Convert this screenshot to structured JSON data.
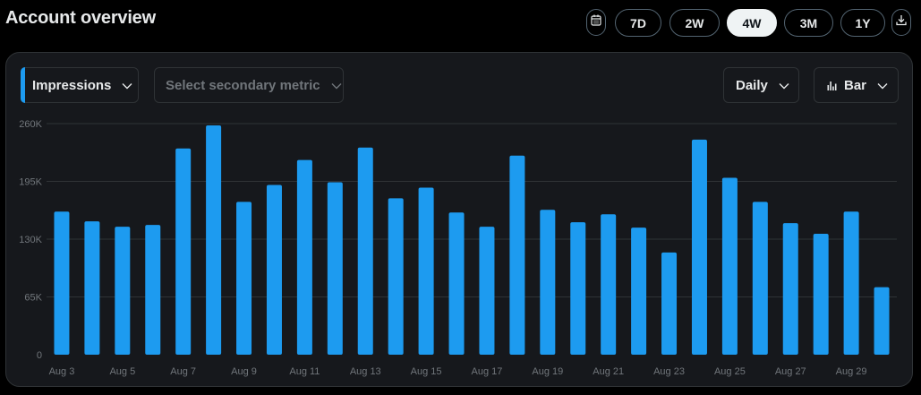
{
  "header": {
    "title": "Account overview"
  },
  "range": {
    "options": [
      "7D",
      "2W",
      "4W",
      "3M",
      "1Y"
    ],
    "selected": "4W",
    "calendar_icon": "calendar-icon",
    "download_icon": "download-icon"
  },
  "controls": {
    "primary_metric": "Impressions",
    "secondary_metric_placeholder": "Select secondary metric",
    "granularity": "Daily",
    "chart_type_label": "Bar",
    "chart_type_icon": "bar-chart-icon",
    "chevron_icon": "chevron-down-icon"
  },
  "colors": {
    "bar": "#1d9bf0",
    "grid": "#2f3336",
    "accent": "#1d9bf0"
  },
  "chart_data": {
    "type": "bar",
    "categories": [
      "Aug 3",
      "Aug 4",
      "Aug 5",
      "Aug 6",
      "Aug 7",
      "Aug 8",
      "Aug 9",
      "Aug 10",
      "Aug 11",
      "Aug 12",
      "Aug 13",
      "Aug 14",
      "Aug 15",
      "Aug 16",
      "Aug 17",
      "Aug 18",
      "Aug 19",
      "Aug 20",
      "Aug 21",
      "Aug 22",
      "Aug 23",
      "Aug 24",
      "Aug 25",
      "Aug 26",
      "Aug 27",
      "Aug 28",
      "Aug 29",
      "Aug 30"
    ],
    "tick_labels": [
      "Aug 3",
      "Aug 5",
      "Aug 7",
      "Aug 9",
      "Aug 11",
      "Aug 13",
      "Aug 15",
      "Aug 17",
      "Aug 19",
      "Aug 21",
      "Aug 23",
      "Aug 25",
      "Aug 27",
      "Aug 29"
    ],
    "values": [
      161000,
      150000,
      144000,
      146000,
      232000,
      258000,
      172000,
      191000,
      219000,
      194000,
      233000,
      176000,
      188000,
      160000,
      144000,
      224000,
      163000,
      149000,
      158000,
      143000,
      115000,
      242000,
      199000,
      172000,
      148000,
      136000,
      161000,
      76000
    ],
    "y_ticks": [
      "0",
      "65K",
      "130K",
      "195K",
      "260K"
    ],
    "ylim": [
      0,
      260000
    ],
    "grid": true,
    "title": "",
    "xlabel": "",
    "ylabel": ""
  }
}
